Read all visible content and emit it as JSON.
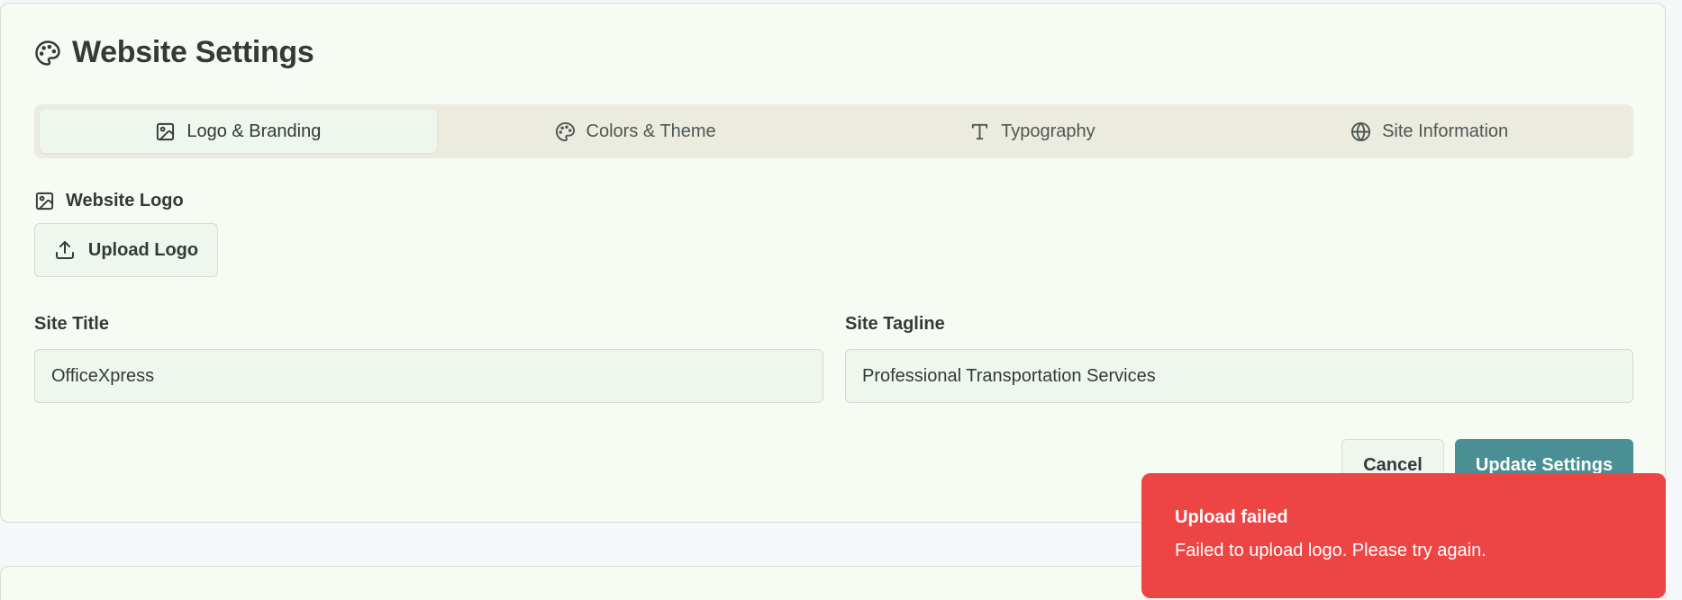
{
  "header": {
    "title": "Website Settings",
    "icon": "palette-icon"
  },
  "tabs": [
    {
      "label": "Logo & Branding",
      "icon": "image-icon",
      "active": true
    },
    {
      "label": "Colors & Theme",
      "icon": "palette-icon",
      "active": false
    },
    {
      "label": "Typography",
      "icon": "type-icon",
      "active": false
    },
    {
      "label": "Site Information",
      "icon": "globe-icon",
      "active": false
    }
  ],
  "logo_section": {
    "label": "Website Logo",
    "upload_button": "Upload Logo"
  },
  "fields": {
    "site_title": {
      "label": "Site Title",
      "value": "OfficeXpress"
    },
    "site_tagline": {
      "label": "Site Tagline",
      "value": "Professional Transportation Services"
    }
  },
  "actions": {
    "cancel": "Cancel",
    "update": "Update Settings"
  },
  "toast": {
    "title": "Upload failed",
    "message": "Failed to upload logo. Please try again.",
    "color": "#ef4444"
  },
  "colors": {
    "accent": "#4a8f94",
    "card_bg": "#f6fbf4",
    "error": "#ef4444"
  }
}
